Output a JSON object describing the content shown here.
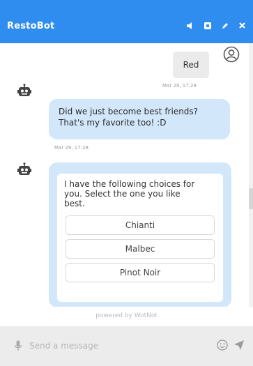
{
  "header": {
    "title": "RestoBot",
    "color": "#2f8df0",
    "icons": [
      "speaker-icon",
      "expand-icon",
      "pencil-icon",
      "close-icon"
    ]
  },
  "messages": {
    "user_message": {
      "text": "Red",
      "timestamp": "Mar 29, 17:28"
    },
    "bot_message_1": {
      "text_line1": "Did we just become best friends?",
      "text_line2": "That's my favorite too! :D",
      "timestamp": "Mar 29, 17:28"
    },
    "bot_card": {
      "text_line1": "I have the following choices for",
      "text_line2": "you. Select the one you like",
      "text_line3": "best.",
      "choices": [
        {
          "label": "Chianti"
        },
        {
          "label": "Malbec"
        },
        {
          "label": "Pinot Noir"
        }
      ]
    }
  },
  "footer": {
    "powered_by": "powered by WotNot"
  },
  "input": {
    "placeholder": "Send a message"
  },
  "colors": {
    "bot_bubble": "#d3e7fb",
    "user_bubble": "#ebebeb",
    "input_bar": "#ececec"
  }
}
